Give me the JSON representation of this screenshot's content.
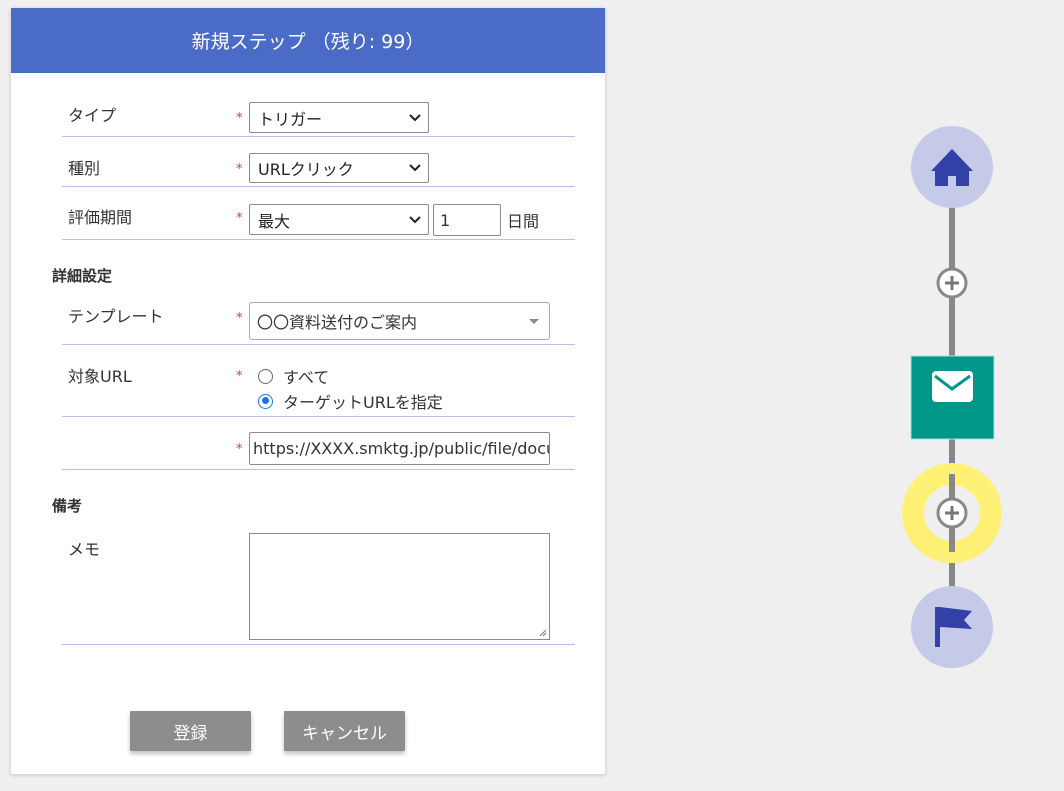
{
  "dialog": {
    "title": "新規ステップ （残り: 99）"
  },
  "fields": {
    "type": {
      "label": "タイプ",
      "value": "トリガー"
    },
    "kind": {
      "label": "種別",
      "value": "URLクリック"
    },
    "period": {
      "label": "評価期間",
      "value": "最大",
      "number": "1",
      "unit": "日間"
    }
  },
  "details": {
    "section_title": "詳細設定",
    "template": {
      "label": "テンプレート",
      "value": "〇〇資料送付のご案内"
    },
    "target_url": {
      "label": "対象URL",
      "options": [
        "すべて",
        "ターゲットURLを指定"
      ],
      "selected": "ターゲットURLを指定",
      "url_value": "https://XXXX.smktg.jp/public/file/docur"
    }
  },
  "notes": {
    "section_title": "備考",
    "memo_label": "メモ",
    "memo_value": ""
  },
  "buttons": {
    "register": "登録",
    "cancel": "キャンセル"
  },
  "required_mark": "*",
  "colors": {
    "header": "#4a6cc7",
    "required": "#e53935",
    "button": "#8d8d8d",
    "node_circle": "#c5cae9",
    "node_icon": "#3240a8",
    "email_node": "#009688",
    "highlight_ring": "#fff176",
    "connector": "#888888"
  },
  "flow": {
    "nodes": [
      "home-icon",
      "add-step-icon",
      "mail-icon",
      "add-step-icon",
      "flag-icon"
    ]
  }
}
